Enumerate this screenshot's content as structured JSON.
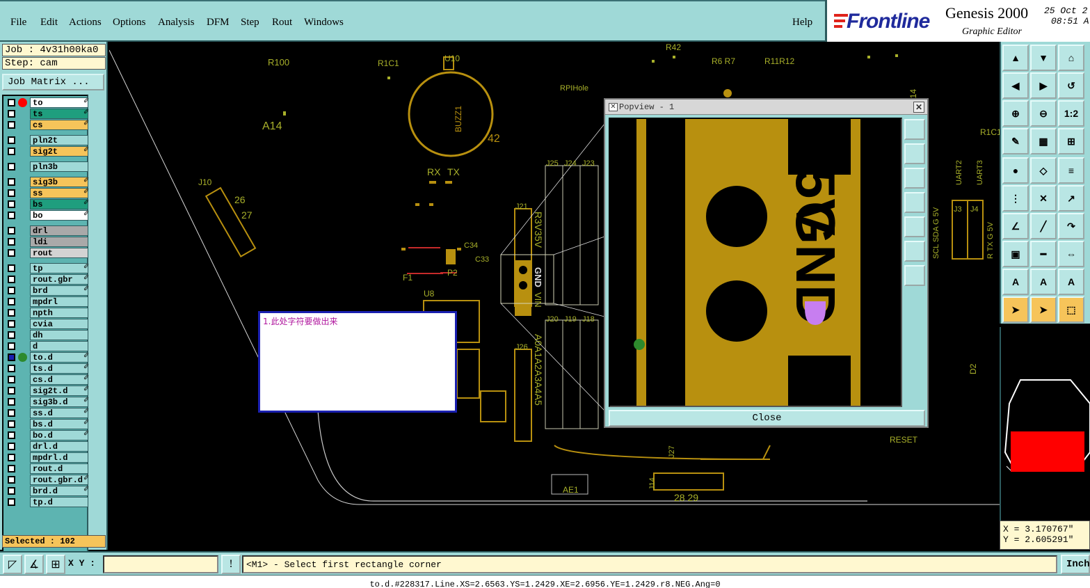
{
  "menubar": {
    "items": [
      "File",
      "Edit",
      "Actions",
      "Options",
      "Analysis",
      "DFM",
      "Step",
      "Rout",
      "Windows"
    ],
    "help": "Help"
  },
  "brand": {
    "logo": "Frontline",
    "app": "Genesis 2000",
    "sub": "Graphic Editor",
    "date_line1": "25 Oct 2",
    "date_line2": "08:51 A"
  },
  "left": {
    "job": "Job : 4v31h00ka0",
    "step": "Step: cam",
    "job_matrix": "Job Matrix ...",
    "selected": "Selected : 102"
  },
  "layers": [
    {
      "name": "to",
      "color": "#ffffff",
      "mark": "#ff0000",
      "pen": true
    },
    {
      "name": "ts",
      "color": "#1f9e7e",
      "pen": true
    },
    {
      "name": "cs",
      "color": "#f6c45a",
      "pen": true
    },
    {
      "name": "pln2t",
      "color": "#9fd9d7",
      "pen": false
    },
    {
      "name": "sig2t",
      "color": "#f6c45a",
      "pen": true
    },
    {
      "name": "pln3b",
      "color": "#9fd9d7",
      "pen": false
    },
    {
      "name": "sig3b",
      "color": "#f6c45a",
      "pen": true
    },
    {
      "name": "ss",
      "color": "#f6c45a",
      "pen": true
    },
    {
      "name": "bs",
      "color": "#1f9e7e",
      "pen": true
    },
    {
      "name": "bo",
      "color": "#ffffff",
      "pen": true
    },
    {
      "name": "drl",
      "color": "#a9a9a9",
      "pen": false
    },
    {
      "name": "ldi",
      "color": "#a9a9a9",
      "pen": false
    },
    {
      "name": "rout",
      "color": "#d3d3d3",
      "pen": false
    },
    {
      "name": "tp",
      "color": "#9fd9d7",
      "pen": true
    },
    {
      "name": "rout.gbr",
      "color": "#9fd9d7",
      "pen": true
    },
    {
      "name": "brd",
      "color": "#9fd9d7",
      "pen": true
    },
    {
      "name": "mpdrl",
      "color": "#9fd9d7",
      "pen": false
    },
    {
      "name": "npth",
      "color": "#9fd9d7",
      "pen": false
    },
    {
      "name": "cvia",
      "color": "#9fd9d7",
      "pen": false
    },
    {
      "name": "dh",
      "color": "#9fd9d7",
      "pen": false
    },
    {
      "name": "d",
      "color": "#9fd9d7",
      "pen": false
    },
    {
      "name": "to.d",
      "color": "#9fd9d7",
      "mark": "#2d8a2d",
      "pen": true,
      "active": true
    },
    {
      "name": "ts.d",
      "color": "#9fd9d7",
      "pen": true
    },
    {
      "name": "cs.d",
      "color": "#9fd9d7",
      "pen": true
    },
    {
      "name": "sig2t.d",
      "color": "#9fd9d7",
      "pen": true
    },
    {
      "name": "sig3b.d",
      "color": "#9fd9d7",
      "pen": true
    },
    {
      "name": "ss.d",
      "color": "#9fd9d7",
      "pen": true
    },
    {
      "name": "bs.d",
      "color": "#9fd9d7",
      "pen": true
    },
    {
      "name": "bo.d",
      "color": "#9fd9d7",
      "pen": true
    },
    {
      "name": "drl.d",
      "color": "#9fd9d7",
      "pen": false
    },
    {
      "name": "mpdrl.d",
      "color": "#9fd9d7",
      "pen": false
    },
    {
      "name": "rout.d",
      "color": "#9fd9d7",
      "pen": false
    },
    {
      "name": "rout.gbr.d",
      "color": "#9fd9d7",
      "pen": true
    },
    {
      "name": "brd.d",
      "color": "#9fd9d7",
      "pen": true
    },
    {
      "name": "tp.d",
      "color": "#9fd9d7",
      "pen": false
    }
  ],
  "canvas_labels": {
    "r100": "R100",
    "r1c1": "R1C1",
    "u10": "U10",
    "a14": "A14",
    "j10": "J10",
    "buzz1": "BUZZ1",
    "n42": "42",
    "rx": "RX",
    "tx": "TX",
    "r26_27": "26",
    "n27": "27",
    "f1": "F1",
    "p2": "P2",
    "u8": "U8",
    "c33": "C33",
    "c34": "C34",
    "rpi": "RPIHole",
    "j25": "J25",
    "j24": "J24",
    "j23": "J23",
    "j21": "J21",
    "j20": "J20",
    "j19": "J19",
    "j18": "J18",
    "j26": "J26",
    "pin_labels_top": "R3V35V",
    "gnd": "GND",
    "vin": "VIN",
    "pin_labels_bottom": "A0A1A2A3A4A5",
    "r5r7": "R6 R7",
    "r11r12": "R11R12",
    "r42": "R42",
    "c14": "C14",
    "r1c": "R1C1",
    "uart2": "UART2",
    "uart3": "UART3",
    "j3": "J3",
    "j4": "J4",
    "scl": "SCL SDA G 5V",
    "rtx": "R  TX G 5V",
    "ae1": "AE1",
    "j14": "J14",
    "n28_29": "28 29",
    "reset": "RESET",
    "d2": "D2",
    "j27": "J27"
  },
  "note": {
    "text": "1.此处字符要做出来"
  },
  "popview": {
    "title": "Popview - 1",
    "close": "Close",
    "big_text_top": "5V",
    "big_text_mid": "GND",
    "big_text_bot": "5V"
  },
  "right_tools": {
    "zoom_ratio": "1:2"
  },
  "coords": {
    "x": "X = 3.170767\"",
    "y": "Y = 2.605291\""
  },
  "bottom": {
    "xy_label": "X Y :",
    "xy_value": "",
    "prompt": "<M1> - Select first rectangle corner",
    "units": "Inch",
    "status": "to.d.#228317.Line.XS=2.6563.YS=1.2429.XE=2.6956.YE=1.2429.r8.NEG.Ang=0"
  },
  "colors": {
    "panel": "#9fd9d7",
    "copper": "#b8900f",
    "silk_green": "#a8b02a",
    "selection": "#d6d6b8",
    "accent_orange": "#f6c45a",
    "pad_purple": "#c77ef0"
  }
}
